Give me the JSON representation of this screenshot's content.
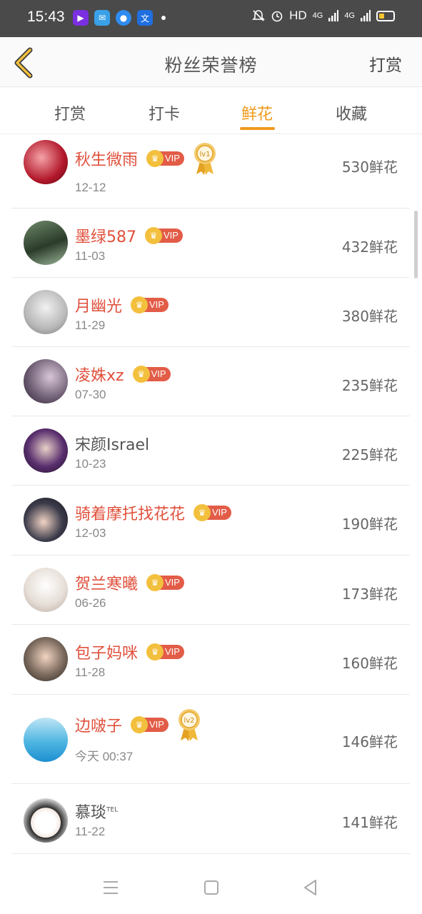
{
  "status": {
    "time": "15:43",
    "network": "HD",
    "signal1": "4G",
    "signal2": "4G"
  },
  "header": {
    "title": "粉丝荣誉榜",
    "action": "打赏"
  },
  "tabs": [
    {
      "label": "打赏"
    },
    {
      "label": "打卡"
    },
    {
      "label": "鲜花"
    },
    {
      "label": "收藏"
    }
  ],
  "active_tab": "鲜花",
  "vip_label": "VIP",
  "fans": [
    {
      "name": "秋生微雨",
      "date": "12-12",
      "amount": "530鲜花",
      "vip": true,
      "medal": "lv1"
    },
    {
      "name": "墨绿587",
      "date": "11-03",
      "amount": "432鲜花",
      "vip": true
    },
    {
      "name": "月幽光",
      "date": "11-29",
      "amount": "380鲜花",
      "vip": true
    },
    {
      "name": "凌姝xz",
      "date": "07-30",
      "amount": "235鲜花",
      "vip": true
    },
    {
      "name": "宋颜Israel",
      "date": "10-23",
      "amount": "225鲜花",
      "vip": false
    },
    {
      "name": "骑着摩托找花花",
      "date": "12-03",
      "amount": "190鲜花",
      "vip": true
    },
    {
      "name": "贺兰寒曦",
      "date": "06-26",
      "amount": "173鲜花",
      "vip": true
    },
    {
      "name": "包子妈咪",
      "date": "11-28",
      "amount": "160鲜花",
      "vip": true
    },
    {
      "name": "边啵子",
      "date": "今天 00:37",
      "amount": "146鲜花",
      "vip": true,
      "medal": "lv2"
    },
    {
      "name": "慕琰",
      "name_sup": "TEL",
      "date": "11-22",
      "amount": "141鲜花",
      "vip": false
    }
  ],
  "colors": {
    "accent": "#ee9a1d",
    "vip_name": "#e0503c",
    "vip_badge": "#e25c47",
    "crown": "#f3c03e"
  }
}
